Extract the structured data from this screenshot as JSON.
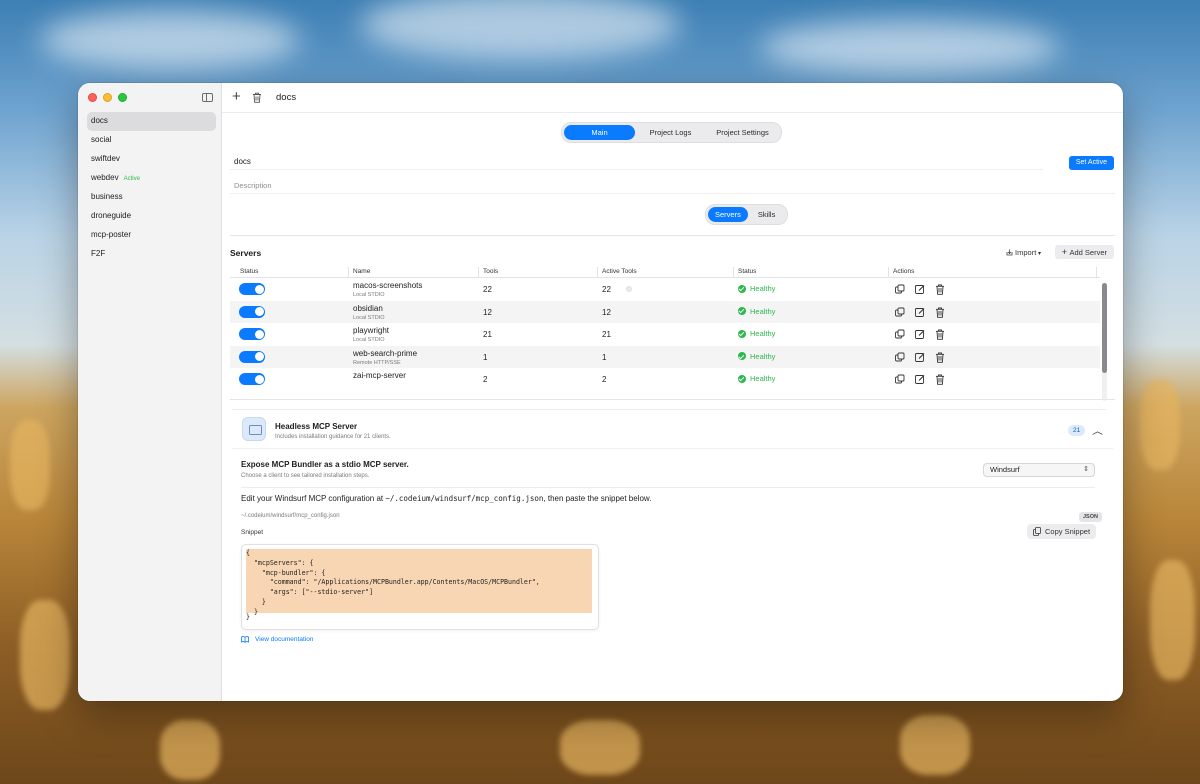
{
  "window": {
    "title": "docs"
  },
  "sidebar": {
    "items": [
      {
        "label": "docs",
        "badge": ""
      },
      {
        "label": "social",
        "badge": ""
      },
      {
        "label": "swiftdev",
        "badge": ""
      },
      {
        "label": "webdev",
        "badge": "Active"
      },
      {
        "label": "business",
        "badge": ""
      },
      {
        "label": "droneguide",
        "badge": ""
      },
      {
        "label": "mcp-poster",
        "badge": ""
      },
      {
        "label": "F2F",
        "badge": ""
      }
    ],
    "selected": "docs"
  },
  "tabs": {
    "main": "Main",
    "logs": "Project Logs",
    "settings": "Project Settings",
    "active": "Main"
  },
  "project": {
    "name": "docs",
    "description_placeholder": "Description",
    "set_active_label": "Set Active"
  },
  "subtabs": {
    "servers": "Servers",
    "skills": "Skills",
    "active": "Servers"
  },
  "servers_section": {
    "title": "Servers",
    "import_label": "Import",
    "add_label": "Add Server",
    "columns": [
      "Status",
      "Name",
      "Tools",
      "Active Tools",
      "Status",
      "Actions"
    ],
    "rows": [
      {
        "enabled": true,
        "name": "macos-screenshots",
        "type": "Local STDIO",
        "tools": "22",
        "active_tools": "22",
        "status": "Healthy"
      },
      {
        "enabled": true,
        "name": "obsidian",
        "type": "Local STDIO",
        "tools": "12",
        "active_tools": "12",
        "status": "Healthy"
      },
      {
        "enabled": true,
        "name": "playwright",
        "type": "Local STDIO",
        "tools": "21",
        "active_tools": "21",
        "status": "Healthy"
      },
      {
        "enabled": true,
        "name": "web-search-prime",
        "type": "Remote HTTP/SSE",
        "tools": "1",
        "active_tools": "1",
        "status": "Healthy"
      },
      {
        "enabled": true,
        "name": "zai-mcp-server",
        "type": "",
        "tools": "2",
        "active_tools": "2",
        "status": "Healthy"
      }
    ]
  },
  "headless": {
    "title": "Headless MCP Server",
    "subtitle": "Includes installation guidance for 21 clients.",
    "count": "21",
    "expose_title": "Expose MCP Bundler as a stdio MCP server.",
    "expose_sub": "Choose a client to see tailored installation steps.",
    "client_select": "Windsurf",
    "edit_prefix": "Edit your Windsurf MCP configuration at ",
    "edit_path": "~/.codeium/windsurf/mcp_config.json",
    "edit_suffix": ", then paste the snippet below.",
    "config_path": "~/.codeium/windsurf/mcp_config.json",
    "format_badge": "JSON",
    "snippet_label": "Snippet",
    "copy_label": "Copy Snippet",
    "snippet": "{\n  \"mcpServers\": {\n    \"mcp-bundler\": {\n      \"command\": \"/Applications/MCPBundler.app/Contents/MacOS/MCPBundler\",\n      \"args\": [\"--stdio-server\"]\n    }\n  }",
    "snippet_last": "}",
    "docs_link": "View documentation"
  },
  "colors": {
    "accent": "#0a7aff",
    "healthy": "#2db84c",
    "snippet_bg": "#f9d6b3"
  }
}
